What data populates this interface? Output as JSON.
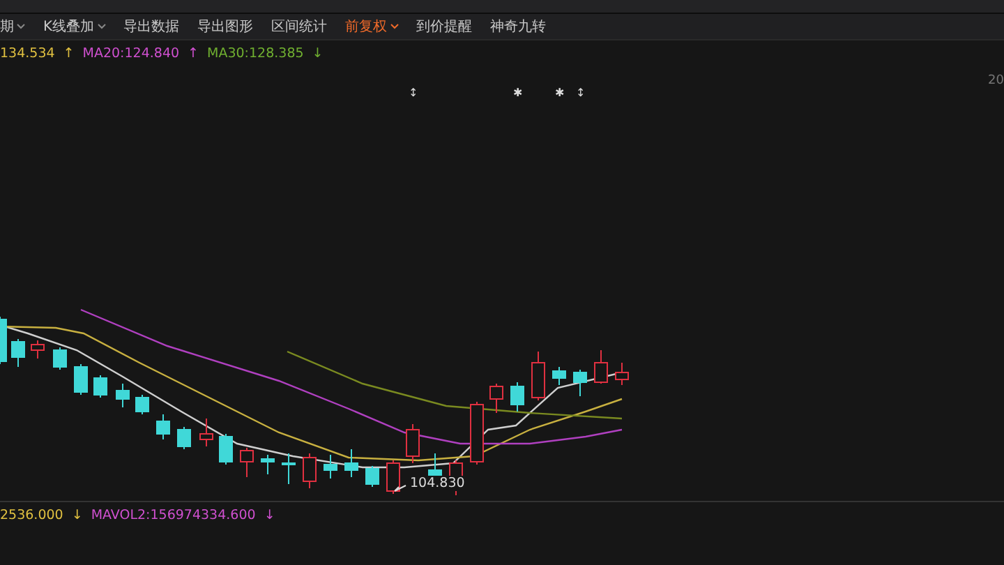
{
  "toolbar": {
    "items": [
      {
        "label": "期",
        "dropdown": true,
        "selected": false
      },
      {
        "label": "K线叠加",
        "dropdown": true,
        "selected": false
      },
      {
        "label": "导出数据",
        "dropdown": false,
        "selected": false
      },
      {
        "label": "导出图形",
        "dropdown": false,
        "selected": false
      },
      {
        "label": "区间统计",
        "dropdown": false,
        "selected": false
      },
      {
        "label": "前复权",
        "dropdown": true,
        "selected": true
      },
      {
        "label": "到价提醒",
        "dropdown": false,
        "selected": false
      },
      {
        "label": "神奇九转",
        "dropdown": false,
        "selected": false
      }
    ]
  },
  "ma_legend": [
    {
      "text": "134.534",
      "color": "#e0c040",
      "trend": "↑"
    },
    {
      "text": "MA20:124.840",
      "color": "#d050d0",
      "trend": "↑"
    },
    {
      "text": "MA30:128.385",
      "color": "#70b030",
      "trend": "↓"
    }
  ],
  "chart": {
    "axis_label": "20",
    "markers": [
      "↕",
      "✱",
      "✱",
      "↕"
    ],
    "low_label": "104.830"
  },
  "volume_legend": [
    {
      "text": "2536.000",
      "color": "#e0c040",
      "trend": "↓"
    },
    {
      "text": "MAVOL2:156974334.600",
      "color": "#d050d0",
      "trend": "↓"
    }
  ]
}
